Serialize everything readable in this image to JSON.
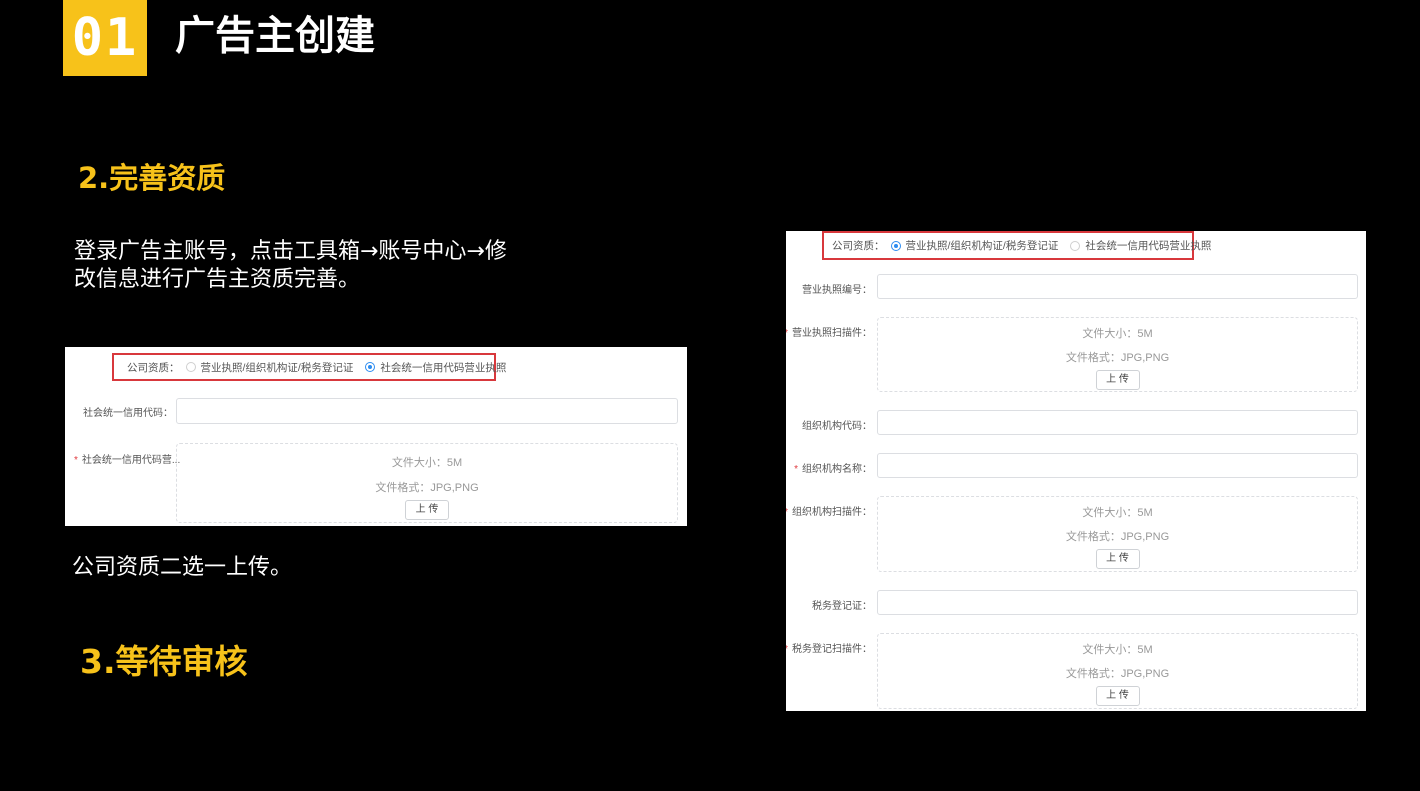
{
  "header": {
    "badge": "01",
    "title": "广告主创建"
  },
  "steps": {
    "step2_title": "2.完善资质",
    "step2_desc": "登录广告主账号，点击工具箱→账号中心→修改信息进行广告主资质完善。",
    "step2_note": "公司资质二选一上传。",
    "step3_title": "3.等待审核"
  },
  "left_form": {
    "qual_label": "公司资质：",
    "option_a": "营业执照/组织机构证/税务登记证",
    "option_b": "社会统一信用代码营业执照",
    "selected": "option_b",
    "field1_label": "社会统一信用代码：",
    "field2_label": "社会统一信用代码营...",
    "size_text": "文件大小：5M",
    "format_text": "文件格式：JPG,PNG",
    "upload_label": "上 传"
  },
  "right_form": {
    "qual_label": "公司资质：",
    "option_a": "营业执照/组织机构证/税务登记证",
    "option_b": "社会统一信用代码营业执照",
    "selected": "option_a",
    "license_no_label": "营业执照编号：",
    "license_scan_label": "营业执照扫描件：",
    "org_code_label": "组织机构代码：",
    "org_name_label": "组织机构名称：",
    "org_scan_label": "组织机构扫描件：",
    "tax_label": "税务登记证：",
    "tax_scan_label": "税务登记扫描件：",
    "size_text": "文件大小：5M",
    "format_text": "文件格式：JPG,PNG",
    "upload_label": "上 传"
  }
}
